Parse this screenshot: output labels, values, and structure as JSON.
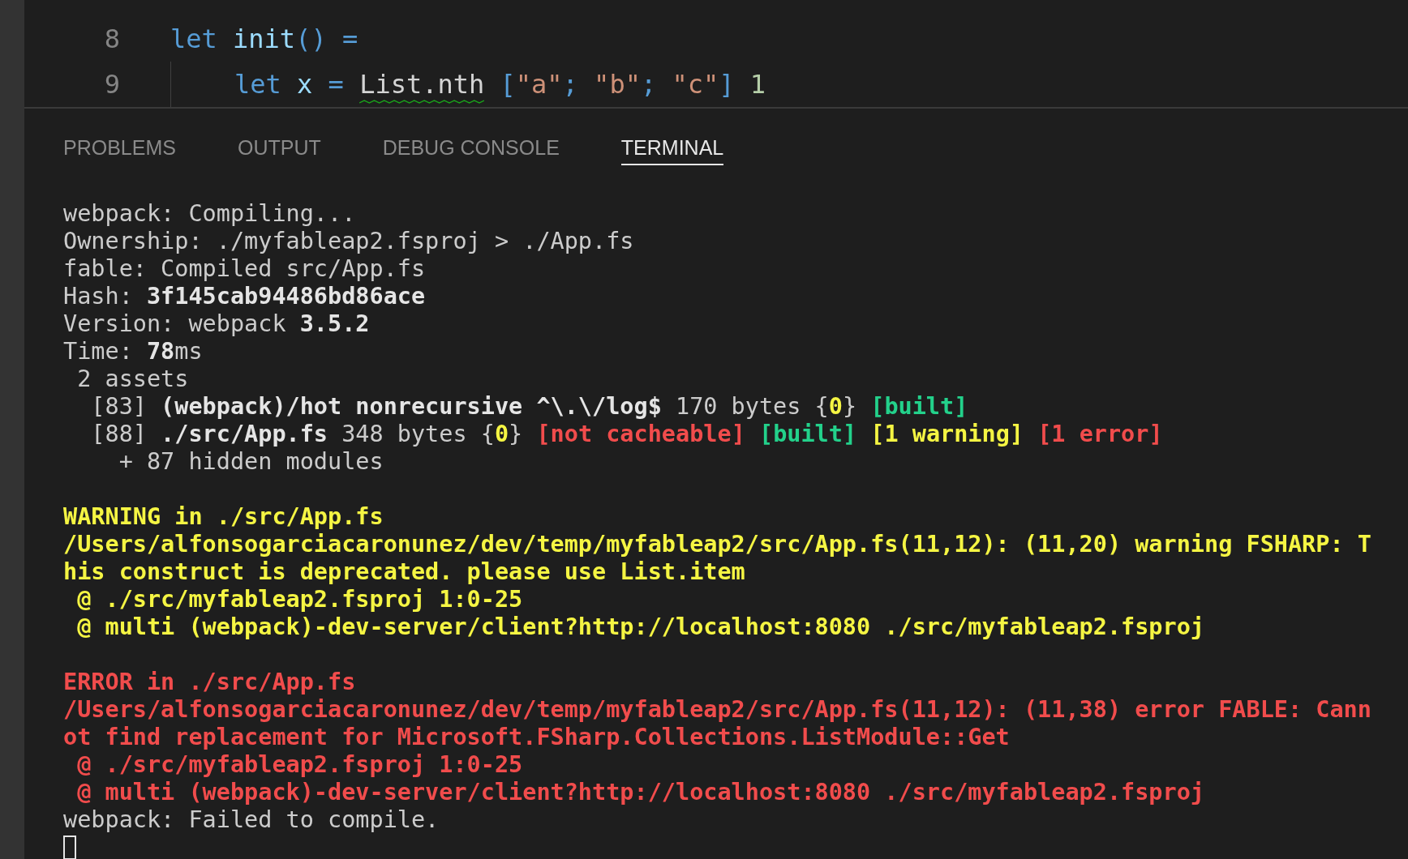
{
  "editor": {
    "lines": [
      {
        "number": "8",
        "indent": false,
        "tokens": [
          {
            "text": "let ",
            "color": "#569cd6"
          },
          {
            "text": "init",
            "color": "#9cdcfe"
          },
          {
            "text": "() =",
            "color": "#569cd6"
          }
        ]
      },
      {
        "number": "9",
        "indent": true,
        "tokens": [
          {
            "text": "let ",
            "color": "#569cd6"
          },
          {
            "text": "x",
            "color": "#9cdcfe"
          },
          {
            "text": " = ",
            "color": "#569cd6"
          },
          {
            "text": "List.nth",
            "color": "#d4d4d4",
            "squiggly": true
          },
          {
            "text": " [",
            "color": "#569cd6"
          },
          {
            "text": "\"a\"",
            "color": "#ce9178"
          },
          {
            "text": "; ",
            "color": "#569cd6"
          },
          {
            "text": "\"b\"",
            "color": "#ce9178"
          },
          {
            "text": "; ",
            "color": "#569cd6"
          },
          {
            "text": "\"c\"",
            "color": "#ce9178"
          },
          {
            "text": "] ",
            "color": "#569cd6"
          },
          {
            "text": "1",
            "color": "#b5cea8"
          }
        ]
      }
    ]
  },
  "tabs": [
    {
      "label": "PROBLEMS",
      "selected": false
    },
    {
      "label": "OUTPUT",
      "selected": false
    },
    {
      "label": "DEBUG CONSOLE",
      "selected": false
    },
    {
      "label": "TERMINAL",
      "selected": true
    }
  ],
  "terminal": {
    "cursor": true,
    "lines": [
      {
        "kind": "text",
        "segments": [
          {
            "text": "webpack: Compiling...",
            "color": "#cccccc",
            "bold": false
          }
        ]
      },
      {
        "kind": "text",
        "segments": [
          {
            "text": "Ownership: ./myfableap2.fsproj > ./App.fs",
            "color": "#cccccc",
            "bold": false
          }
        ]
      },
      {
        "kind": "text",
        "segments": [
          {
            "text": "fable: Compiled src/App.fs",
            "color": "#cccccc",
            "bold": false
          }
        ]
      },
      {
        "kind": "text",
        "segments": [
          {
            "text": "Hash: ",
            "color": "#cccccc",
            "bold": false
          },
          {
            "text": "3f145cab94486bd86ace",
            "color": "#e5e5e5",
            "bold": true
          }
        ]
      },
      {
        "kind": "text",
        "segments": [
          {
            "text": "Version: webpack ",
            "color": "#cccccc",
            "bold": false
          },
          {
            "text": "3.5.2",
            "color": "#e5e5e5",
            "bold": true
          }
        ]
      },
      {
        "kind": "text",
        "segments": [
          {
            "text": "Time: ",
            "color": "#cccccc",
            "bold": false
          },
          {
            "text": "78",
            "color": "#e5e5e5",
            "bold": true
          },
          {
            "text": "ms",
            "color": "#cccccc",
            "bold": false
          }
        ]
      },
      {
        "kind": "text",
        "segments": [
          {
            "text": " 2 assets",
            "color": "#cccccc",
            "bold": false
          }
        ]
      },
      {
        "kind": "text",
        "segments": [
          {
            "text": "  [83] ",
            "color": "#cccccc",
            "bold": false
          },
          {
            "text": "(webpack)/hot nonrecursive ^\\.\\/log$",
            "color": "#e5e5e5",
            "bold": true
          },
          {
            "text": " 170 bytes {",
            "color": "#cccccc",
            "bold": false
          },
          {
            "text": "0",
            "color": "#f5f543",
            "bold": true
          },
          {
            "text": "} ",
            "color": "#cccccc",
            "bold": false
          },
          {
            "text": "[built]",
            "color": "#23d18b",
            "bold": true
          }
        ]
      },
      {
        "kind": "text",
        "segments": [
          {
            "text": "  [88] ",
            "color": "#cccccc",
            "bold": false
          },
          {
            "text": "./src/App.fs",
            "color": "#e5e5e5",
            "bold": true
          },
          {
            "text": " 348 bytes {",
            "color": "#cccccc",
            "bold": false
          },
          {
            "text": "0",
            "color": "#f5f543",
            "bold": true
          },
          {
            "text": "} ",
            "color": "#cccccc",
            "bold": false
          },
          {
            "text": "[not cacheable]",
            "color": "#f14c4c",
            "bold": true
          },
          {
            "text": " [built]",
            "color": "#23d18b",
            "bold": true
          },
          {
            "text": " [1 warning]",
            "color": "#f5f543",
            "bold": true
          },
          {
            "text": " [1 error]",
            "color": "#f14c4c",
            "bold": true
          }
        ]
      },
      {
        "kind": "text",
        "segments": [
          {
            "text": "    + 87 hidden modules",
            "color": "#cccccc",
            "bold": false
          }
        ]
      },
      {
        "kind": "blank"
      },
      {
        "kind": "text",
        "segments": [
          {
            "text": "WARNING in ./src/App.fs",
            "color": "#f5f543",
            "bold": true
          }
        ]
      },
      {
        "kind": "text",
        "segments": [
          {
            "text": "/Users/alfonsogarciacaronunez/dev/temp/myfableap2/src/App.fs(11,12): (11,20) warning FSHARP: T",
            "color": "#f5f543",
            "bold": true
          }
        ]
      },
      {
        "kind": "text",
        "segments": [
          {
            "text": "his construct is deprecated. please use List.item",
            "color": "#f5f543",
            "bold": true
          }
        ]
      },
      {
        "kind": "text",
        "segments": [
          {
            "text": " @ ./src/myfableap2.fsproj 1:0-25",
            "color": "#f5f543",
            "bold": true
          }
        ]
      },
      {
        "kind": "text",
        "segments": [
          {
            "text": " @ multi (webpack)-dev-server/client?http://localhost:8080 ./src/myfableap2.fsproj",
            "color": "#f5f543",
            "bold": true
          }
        ]
      },
      {
        "kind": "blank"
      },
      {
        "kind": "text",
        "segments": [
          {
            "text": "ERROR in ./src/App.fs",
            "color": "#f14c4c",
            "bold": true
          }
        ]
      },
      {
        "kind": "text",
        "segments": [
          {
            "text": "/Users/alfonsogarciacaronunez/dev/temp/myfableap2/src/App.fs(11,12): (11,38) error FABLE: Cann",
            "color": "#f14c4c",
            "bold": true
          }
        ]
      },
      {
        "kind": "text",
        "segments": [
          {
            "text": "ot find replacement for Microsoft.FSharp.Collections.ListModule::Get",
            "color": "#f14c4c",
            "bold": true
          }
        ]
      },
      {
        "kind": "text",
        "segments": [
          {
            "text": " @ ./src/myfableap2.fsproj 1:0-25",
            "color": "#f14c4c",
            "bold": true
          }
        ]
      },
      {
        "kind": "text",
        "segments": [
          {
            "text": " @ multi (webpack)-dev-server/client?http://localhost:8080 ./src/myfableap2.fsproj",
            "color": "#f14c4c",
            "bold": true
          }
        ]
      },
      {
        "kind": "text",
        "segments": [
          {
            "text": "webpack: Failed to compile.",
            "color": "#cccccc",
            "bold": false
          }
        ]
      }
    ]
  }
}
